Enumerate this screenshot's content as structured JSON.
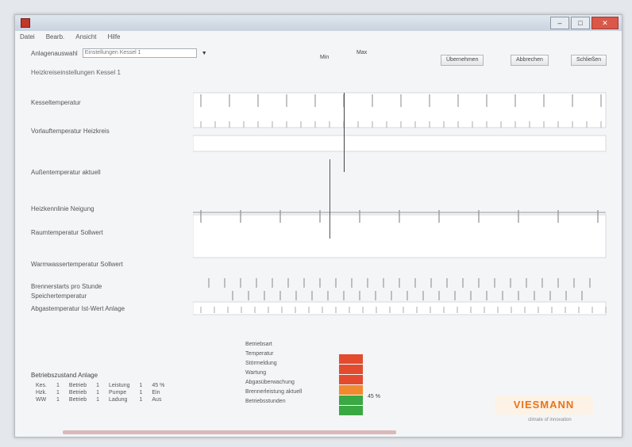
{
  "window": {
    "title": "",
    "controls": [
      "–",
      "□",
      "✕"
    ]
  },
  "menu": {
    "items": [
      "Datei",
      "Bearb.",
      "Ansicht",
      "Hilfe"
    ]
  },
  "header": {
    "selector_label": "Anlagenauswahl",
    "selector_value": "Einstellungen Kessel 1",
    "subtitle": "Heizkreiseinstellungen Kessel 1",
    "mark_left": "Min",
    "mark_right": "Max",
    "buttons": [
      "Übernehmen",
      "Abbrechen",
      "Schließen"
    ]
  },
  "rows": [
    {
      "label": "Kesseltemperatur"
    },
    {
      "label": "Vorlauftemperatur Heizkreis"
    },
    {
      "label": "Außentemperatur aktuell"
    },
    {
      "label": "Heizkennlinie Neigung"
    },
    {
      "label": "Raumtemperatur Sollwert"
    },
    {
      "label": "Warmwassertemperatur Sollwert"
    },
    {
      "label": "Brennerstarts pro Stunde"
    },
    {
      "label": "Speichertemperatur"
    },
    {
      "label": "Abgastemperatur Ist-Wert Anlage"
    }
  ],
  "status": {
    "title": "Betriebszustand Anlage",
    "rows": [
      [
        "Kes.",
        "1",
        "Betrieb",
        "1",
        "Leistung",
        "1",
        "45 %"
      ],
      [
        "Hzk.",
        "1",
        "Betrieb",
        "1",
        "Pumpe",
        "1",
        "Ein"
      ],
      [
        "WW",
        "1",
        "Betrieb",
        "1",
        "Ladung",
        "1",
        "Aus"
      ]
    ]
  },
  "legend": {
    "lines": [
      "Betriebsart",
      "Temperatur",
      "Störmeldung",
      "Wartung",
      "Abgasüberwachung",
      "Brennerleistung aktuell",
      "Betriebsstunden"
    ]
  },
  "bars": {
    "value": "45 %",
    "level_percent": 45,
    "colors": [
      "#e34b2f",
      "#e34b2f",
      "#e34b2f",
      "#f08a2e",
      "#3aa843",
      "#3aa843"
    ]
  },
  "brand": {
    "name": "VIESMANN",
    "tagline": "climate of innovation",
    "color": "#e8741a"
  }
}
